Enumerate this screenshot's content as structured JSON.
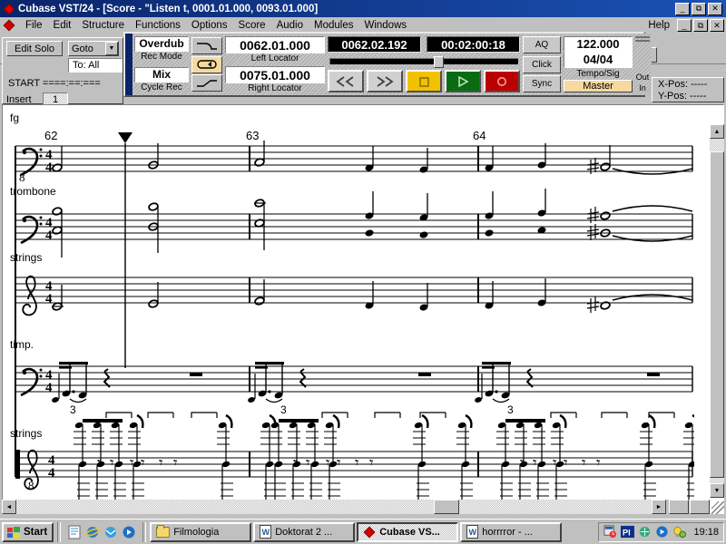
{
  "window": {
    "title": "Cubase VST/24 - [Score - \"Listen t, 0001.01.000, 0093.01.000]",
    "minimize": "_",
    "maximize": "❐",
    "close": "✕",
    "help_label": "Help"
  },
  "menu": {
    "items": [
      {
        "label": "File"
      },
      {
        "label": "Edit"
      },
      {
        "label": "Structure"
      },
      {
        "label": "Functions"
      },
      {
        "label": "Options"
      },
      {
        "label": "Score"
      },
      {
        "label": "Audio"
      },
      {
        "label": "Modules"
      },
      {
        "label": "Windows"
      }
    ]
  },
  "left_panel": {
    "edit_solo": "Edit Solo",
    "goto": "Goto",
    "to_all": "To: All",
    "start": "START ====:==:===",
    "insert_label": "Insert",
    "insert_value": "1"
  },
  "transport": {
    "rec_mode_value": "Overdub",
    "rec_mode_label": "Rec Mode",
    "cycle_rec_value": "Mix",
    "cycle_rec_label": "Cycle Rec",
    "left_locator_value": "0062.01.000",
    "left_locator_label": "Left Locator",
    "right_locator_value": "0075.01.000",
    "right_locator_label": "Right Locator",
    "position_bars": "0062.02.192",
    "position_time": "00:02:00:18",
    "buttons": {
      "rewind": "rewind-icon",
      "forward": "forward-icon",
      "stop": "stop-icon",
      "play": "play-icon",
      "record": "record-icon"
    },
    "aq": "AQ",
    "click": "Click",
    "sync": "Sync",
    "tempo": "122.000",
    "signature": "04/04",
    "tempo_caption": "Tempo/Sig",
    "master": "Master",
    "meter_out": "Out",
    "meter_in": "In"
  },
  "status": {
    "x_pos": "X-Pos: -----",
    "y_pos": "Y-Pos: -----"
  },
  "score": {
    "bar_numbers": [
      "62",
      "63",
      "64"
    ],
    "staff_labels": [
      "fg",
      "trombone",
      "strings",
      "timp.",
      "strings"
    ],
    "time_signature": "4/4",
    "tuplet_label": "3",
    "systems": [
      {
        "name": "fg",
        "clef": "bass-8va-bassa"
      },
      {
        "name": "trombone",
        "clef": "bass"
      },
      {
        "name": "strings",
        "clef": "treble"
      },
      {
        "name": "timp.",
        "clef": "bass"
      },
      {
        "name": "strings",
        "clef": "treble-8va-bassa"
      }
    ]
  },
  "scrollbars": {
    "up_arrow": "▲",
    "down_arrow": "▼",
    "left_arrow": "◄",
    "right_arrow": "►"
  },
  "taskbar": {
    "start": "Start",
    "items": [
      {
        "label": "Filmologia",
        "icon": "folder-icon",
        "active": false
      },
      {
        "label": "Doktorat 2 ...",
        "icon": "word-icon",
        "active": false
      },
      {
        "label": "Cubase VS...",
        "icon": "cubase-icon",
        "active": true
      },
      {
        "label": "horrrror - ...",
        "icon": "word-icon",
        "active": false
      }
    ],
    "clock": "19:18"
  }
}
